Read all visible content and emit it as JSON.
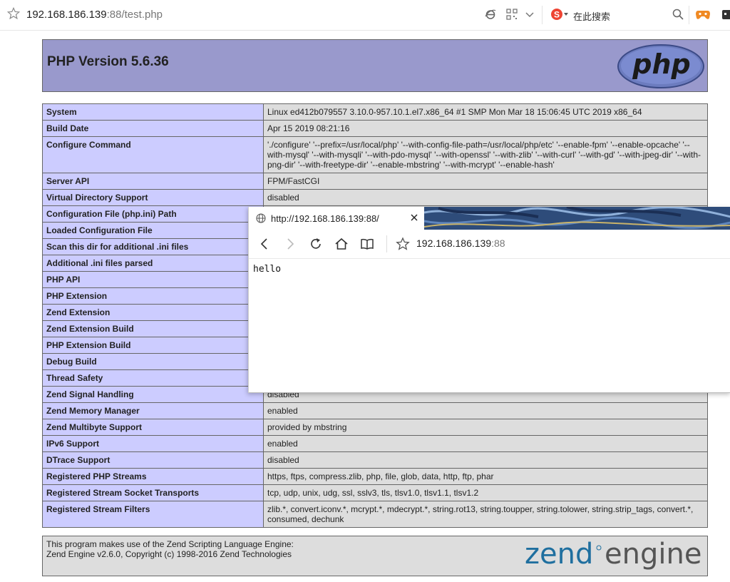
{
  "browser": {
    "address_host": "192.168.186.139",
    "address_rest": ":88/test.php",
    "search_label": "在此搜索",
    "icons": [
      "star-icon",
      "ie-icon",
      "qr-code-icon",
      "chevron-down-icon",
      "sogou-icon",
      "magnifier-icon",
      "game-controller-icon",
      "extension-icon"
    ]
  },
  "php": {
    "title": "PHP Version 5.6.36",
    "logo_text": "php",
    "rows": [
      {
        "k": "System",
        "v": "Linux ed412b079557 3.10.0-957.10.1.el7.x86_64 #1 SMP Mon Mar 18 15:06:45 UTC 2019 x86_64"
      },
      {
        "k": "Build Date",
        "v": "Apr 15 2019 08:21:16"
      },
      {
        "k": "Configure Command",
        "v": "'./configure' '--prefix=/usr/local/php' '--with-config-file-path=/usr/local/php/etc' '--enable-fpm' '--enable-opcache' '--with-mysql' '--with-mysqli' '--with-pdo-mysql' '--with-openssl' '--with-zlib' '--with-curl' '--with-gd' '--with-jpeg-dir' '--with-png-dir' '--with-freetype-dir' '--enable-mbstring' '--with-mcrypt' '--enable-hash'"
      },
      {
        "k": "Server API",
        "v": "FPM/FastCGI"
      },
      {
        "k": "Virtual Directory Support",
        "v": "disabled"
      },
      {
        "k": "Configuration File (php.ini) Path",
        "v": ""
      },
      {
        "k": "Loaded Configuration File",
        "v": ""
      },
      {
        "k": "Scan this dir for additional .ini files",
        "v": ""
      },
      {
        "k": "Additional .ini files parsed",
        "v": ""
      },
      {
        "k": "PHP API",
        "v": ""
      },
      {
        "k": "PHP Extension",
        "v": ""
      },
      {
        "k": "Zend Extension",
        "v": ""
      },
      {
        "k": "Zend Extension Build",
        "v": ""
      },
      {
        "k": "PHP Extension Build",
        "v": ""
      },
      {
        "k": "Debug Build",
        "v": ""
      },
      {
        "k": "Thread Safety",
        "v": ""
      },
      {
        "k": "Zend Signal Handling",
        "v": "disabled"
      },
      {
        "k": "Zend Memory Manager",
        "v": "enabled"
      },
      {
        "k": "Zend Multibyte Support",
        "v": "provided by mbstring"
      },
      {
        "k": "IPv6 Support",
        "v": "enabled"
      },
      {
        "k": "DTrace Support",
        "v": "disabled"
      },
      {
        "k": "Registered PHP Streams",
        "v": "https, ftps, compress.zlib, php, file, glob, data, http, ftp, phar"
      },
      {
        "k": "Registered Stream Socket Transports",
        "v": "tcp, udp, unix, udg, ssl, sslv3, tls, tlsv1.0, tlsv1.1, tlsv1.2"
      },
      {
        "k": "Registered Stream Filters",
        "v": "zlib.*, convert.iconv.*, mcrypt.*, mdecrypt.*, string.rot13, string.toupper, string.tolower, string.strip_tags, convert.*, consumed, dechunk"
      }
    ],
    "zend_line1": "This program makes use of the Zend Scripting Language Engine:",
    "zend_line2": "Zend Engine v2.6.0, Copyright (c) 1998-2016 Zend Technologies",
    "zend_logo_word1": "zend",
    "zend_logo_word2": "engine"
  },
  "popup": {
    "tab_title": "http://192.168.186.139:88/",
    "url_host": "192.168.186.139",
    "url_rest": ":88",
    "content": "hello"
  }
}
